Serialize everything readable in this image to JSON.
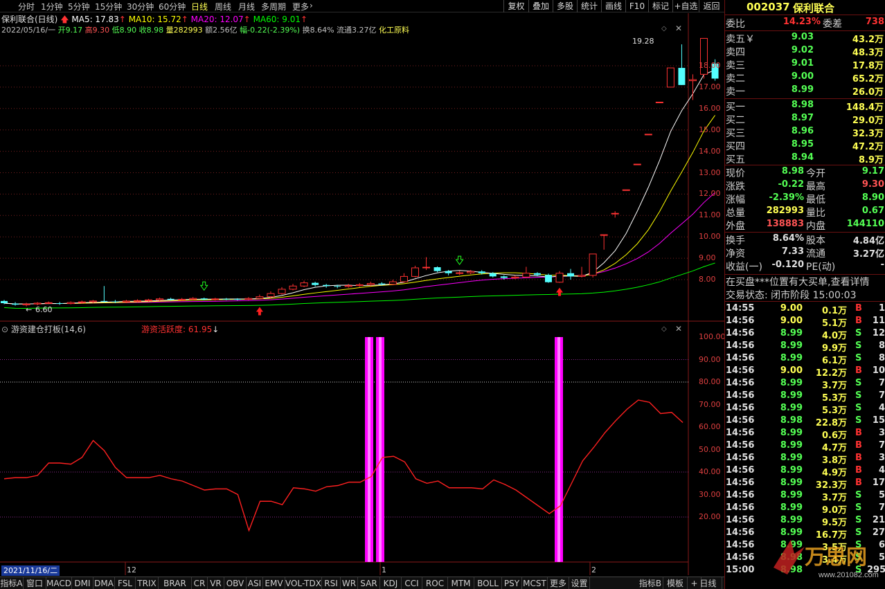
{
  "toolbar": {
    "periods": [
      "分时",
      "1分钟",
      "5分钟",
      "15分钟",
      "30分钟",
      "60分钟",
      "日线",
      "周线",
      "月线",
      "多周期",
      "更多"
    ],
    "active": "日线",
    "right_buttons": [
      "复权",
      "叠加",
      "多股",
      "统计",
      "画线",
      "F10",
      "标记",
      "+自选",
      "返回"
    ]
  },
  "legend": {
    "title": "保利联合(日线)",
    "ma5": "MA5: 17.83",
    "ma10": "MA10: 15.72",
    "ma20": "MA20: 12.07",
    "ma60": "MA60: 9.01",
    "info_date": "2022/05/16/一",
    "info_open": "开9.17",
    "info_high": "高9.30",
    "info_low": "低8.90",
    "info_close": "收8.98",
    "info_vol": "量282993",
    "info_amt": "额2.56亿",
    "info_chg": "幅-0.22(-2.39%)",
    "info_turn": "换8.64%",
    "info_float": "流通3.27亿",
    "info_sector": "化工原料"
  },
  "colors": {
    "up": "#ff3232",
    "down": "#54ffff",
    "ma5": "#ffffff",
    "ma10": "#ffff00",
    "ma20": "#ff00ff",
    "ma60": "#00ff00",
    "indicator_line": "#ff2020",
    "signal_bar": "#ff00ff"
  },
  "price_axis": [
    "18.00",
    "17.00",
    "16.00",
    "15.00",
    "14.00",
    "13.00",
    "12.00",
    "11.00",
    "10.00",
    "9.00",
    "8.00"
  ],
  "price_annot": {
    "high_label": "19.28",
    "low_label": "6.60"
  },
  "indicator": {
    "title": "游资建仓打板(14,6)",
    "reading": "游资活跃度: 61.95",
    "axis": [
      "100.00",
      "90.00",
      "80.00",
      "70.00",
      "60.00",
      "50.00",
      "40.00",
      "30.00",
      "20.00"
    ]
  },
  "x_axis": {
    "current_date": "2021/11/16/二",
    "months": [
      "12",
      "1",
      "2"
    ]
  },
  "chart_data": {
    "type": "line",
    "title": "保利联合(日线)",
    "candles": [
      {
        "o": 7.0,
        "c": 6.9,
        "h": 7.05,
        "l": 6.85
      },
      {
        "o": 6.88,
        "c": 6.83,
        "h": 6.95,
        "l": 6.78
      },
      {
        "o": 6.82,
        "c": 6.86,
        "h": 6.92,
        "l": 6.75
      },
      {
        "o": 6.86,
        "c": 6.9,
        "h": 6.95,
        "l": 6.8
      },
      {
        "o": 6.9,
        "c": 6.92,
        "h": 6.98,
        "l": 6.85
      },
      {
        "o": 6.9,
        "c": 6.88,
        "h": 6.96,
        "l": 6.82
      },
      {
        "o": 6.88,
        "c": 6.93,
        "h": 6.98,
        "l": 6.84
      },
      {
        "o": 6.93,
        "c": 6.96,
        "h": 7.02,
        "l": 6.88
      },
      {
        "o": 6.96,
        "c": 7.0,
        "h": 7.05,
        "l": 6.9
      },
      {
        "o": 7.0,
        "c": 6.98,
        "h": 7.7,
        "l": 6.92
      },
      {
        "o": 6.98,
        "c": 6.96,
        "h": 7.05,
        "l": 6.9
      },
      {
        "o": 6.96,
        "c": 7.0,
        "h": 7.05,
        "l": 6.9
      },
      {
        "o": 7.0,
        "c": 7.02,
        "h": 7.08,
        "l": 6.95
      },
      {
        "o": 7.02,
        "c": 7.05,
        "h": 7.1,
        "l": 6.97
      },
      {
        "o": 7.05,
        "c": 7.1,
        "h": 7.16,
        "l": 7.0
      },
      {
        "o": 7.1,
        "c": 7.06,
        "h": 7.15,
        "l": 7.02
      },
      {
        "o": 7.06,
        "c": 7.08,
        "h": 7.14,
        "l": 7.0
      },
      {
        "o": 7.08,
        "c": 7.12,
        "h": 7.18,
        "l": 7.02
      },
      {
        "o": 7.12,
        "c": 7.07,
        "h": 7.16,
        "l": 7.03
      },
      {
        "o": 7.07,
        "c": 7.1,
        "h": 7.15,
        "l": 7.02
      },
      {
        "o": 7.1,
        "c": 7.09,
        "h": 7.14,
        "l": 7.04
      },
      {
        "o": 7.09,
        "c": 7.08,
        "h": 7.13,
        "l": 7.03
      },
      {
        "o": 7.08,
        "c": 7.12,
        "h": 7.18,
        "l": 7.04
      },
      {
        "o": 7.12,
        "c": 7.2,
        "h": 7.3,
        "l": 7.08
      },
      {
        "o": 7.2,
        "c": 7.35,
        "h": 7.45,
        "l": 7.1
      },
      {
        "o": 7.35,
        "c": 7.55,
        "h": 7.65,
        "l": 7.3
      },
      {
        "o": 7.55,
        "c": 7.7,
        "h": 7.8,
        "l": 7.5
      },
      {
        "o": 7.7,
        "c": 7.85,
        "h": 7.95,
        "l": 7.65
      },
      {
        "o": 7.85,
        "c": 7.75,
        "h": 7.9,
        "l": 7.68
      },
      {
        "o": 7.75,
        "c": 7.7,
        "h": 7.8,
        "l": 7.62
      },
      {
        "o": 7.7,
        "c": 7.68,
        "h": 7.76,
        "l": 7.6
      },
      {
        "o": 7.68,
        "c": 7.72,
        "h": 7.8,
        "l": 7.62
      },
      {
        "o": 7.72,
        "c": 7.76,
        "h": 7.84,
        "l": 7.66
      },
      {
        "o": 7.76,
        "c": 7.82,
        "h": 7.9,
        "l": 7.7
      },
      {
        "o": 7.82,
        "c": 7.78,
        "h": 7.88,
        "l": 7.72
      },
      {
        "o": 7.78,
        "c": 7.9,
        "h": 8.0,
        "l": 7.74
      },
      {
        "o": 7.9,
        "c": 8.15,
        "h": 8.3,
        "l": 7.85
      },
      {
        "o": 8.15,
        "c": 8.55,
        "h": 8.65,
        "l": 8.1
      },
      {
        "o": 8.55,
        "c": 8.58,
        "h": 9.05,
        "l": 8.45
      },
      {
        "o": 8.58,
        "c": 8.4,
        "h": 8.62,
        "l": 8.35
      },
      {
        "o": 8.4,
        "c": 8.3,
        "h": 8.45,
        "l": 8.2
      },
      {
        "o": 8.3,
        "c": 8.32,
        "h": 8.4,
        "l": 8.22
      },
      {
        "o": 8.32,
        "c": 8.38,
        "h": 8.45,
        "l": 8.26
      },
      {
        "o": 8.38,
        "c": 8.3,
        "h": 8.44,
        "l": 8.24
      },
      {
        "o": 8.3,
        "c": 8.15,
        "h": 8.35,
        "l": 8.1
      },
      {
        "o": 8.15,
        "c": 8.08,
        "h": 8.2,
        "l": 8.0
      },
      {
        "o": 8.08,
        "c": 8.12,
        "h": 8.2,
        "l": 8.02
      },
      {
        "o": 8.12,
        "c": 8.3,
        "h": 8.6,
        "l": 8.08
      },
      {
        "o": 8.3,
        "c": 8.22,
        "h": 8.35,
        "l": 8.15
      },
      {
        "o": 8.22,
        "c": 7.88,
        "h": 8.28,
        "l": 7.85
      },
      {
        "o": 7.88,
        "c": 8.3,
        "h": 8.4,
        "l": 7.85
      },
      {
        "o": 8.3,
        "c": 8.15,
        "h": 8.5,
        "l": 8.0
      },
      {
        "o": 8.15,
        "c": 8.2,
        "h": 8.6,
        "l": 8.1
      },
      {
        "o": 8.2,
        "c": 9.2,
        "h": 9.2,
        "l": 8.1
      },
      {
        "o": 10.1,
        "c": 10.1,
        "h": 10.1,
        "l": 9.4
      },
      {
        "o": 11.1,
        "c": 11.1,
        "h": 11.2,
        "l": 10.9
      },
      {
        "o": 12.2,
        "c": 12.2,
        "h": 12.2,
        "l": 12.2
      },
      {
        "o": 13.4,
        "c": 13.4,
        "h": 13.4,
        "l": 13.4
      },
      {
        "o": 14.8,
        "c": 14.8,
        "h": 14.8,
        "l": 14.8
      },
      {
        "o": 16.3,
        "c": 16.3,
        "h": 16.3,
        "l": 16.3
      },
      {
        "o": 17.0,
        "c": 17.9,
        "h": 17.9,
        "l": 17.0
      },
      {
        "o": 17.9,
        "c": 17.1,
        "h": 19.0,
        "l": 17.1
      },
      {
        "o": 17.3,
        "c": 17.35,
        "h": 17.6,
        "l": 16.4
      },
      {
        "o": 17.6,
        "c": 19.28,
        "h": 19.28,
        "l": 17.4
      },
      {
        "o": 18.1,
        "c": 17.4,
        "h": 18.3,
        "l": 17.3
      }
    ],
    "indicator_values": [
      37,
      37.5,
      37.5,
      38.5,
      44,
      44,
      43.5,
      46.5,
      54,
      49.5,
      42,
      37.5,
      37.5,
      37.5,
      38.5,
      37,
      36,
      34,
      32,
      32.5,
      32.5,
      30,
      14,
      27,
      27,
      25.5,
      33,
      32.5,
      31.5,
      33.5,
      34,
      35.5,
      35.5,
      38,
      46.5,
      47,
      44.5,
      37,
      35,
      36,
      33,
      33,
      33,
      32.5,
      36.5,
      34.5,
      32,
      28.5,
      25,
      21.5,
      25,
      35,
      45,
      51,
      57.5,
      63,
      68,
      72,
      71,
      66,
      66.5,
      62
    ]
  }
}
